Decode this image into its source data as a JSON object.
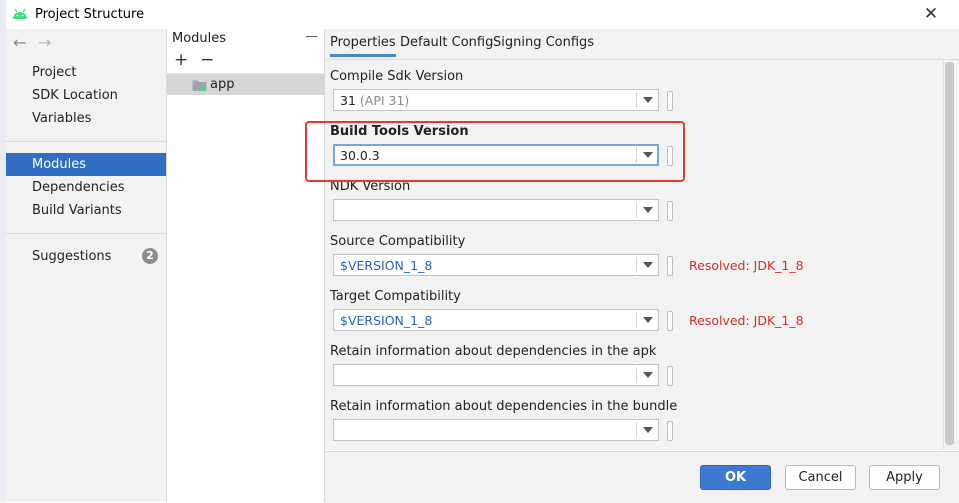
{
  "window": {
    "title": "Project Structure",
    "close_symbol": "✕",
    "app_icon": "android-icon"
  },
  "nav": {
    "back_symbol": "←",
    "forward_symbol": "→",
    "items": [
      {
        "label": "Project"
      },
      {
        "label": "SDK Location"
      },
      {
        "label": "Variables"
      },
      {
        "label": "Modules"
      },
      {
        "label": "Dependencies"
      },
      {
        "label": "Build Variants"
      },
      {
        "label": "Suggestions",
        "badge": "2"
      }
    ],
    "selected": "Modules"
  },
  "modules": {
    "header": "Modules",
    "collapse_symbol": "—",
    "add_symbol": "+",
    "remove_symbol": "−",
    "items": [
      {
        "label": "app"
      }
    ]
  },
  "tabs": [
    {
      "label": "Properties"
    },
    {
      "label": "Default Config"
    },
    {
      "label": "Signing Configs"
    }
  ],
  "fields": [
    {
      "label": "Compile Sdk Version",
      "value": "31",
      "hint": "(API 31)"
    },
    {
      "label": "Build Tools Version",
      "value": "30.0.3"
    },
    {
      "label": "NDK Version",
      "value": ""
    },
    {
      "label": "Source Compatibility",
      "value": "$VERSION_1_8",
      "resolved": "Resolved: JDK_1_8"
    },
    {
      "label": "Target Compatibility",
      "value": "$VERSION_1_8",
      "resolved": "Resolved: JDK_1_8"
    },
    {
      "label": "Retain information about dependencies in the apk",
      "value": ""
    },
    {
      "label": "Retain information about dependencies in the bundle",
      "value": ""
    }
  ],
  "buttons": {
    "ok": "OK",
    "cancel": "Cancel",
    "apply": "Apply"
  },
  "colors": {
    "selection": "#2f6ec1",
    "highlight_box": "#e53935",
    "resolved_text": "#d42b2b",
    "variable_text": "#2a62b4"
  }
}
